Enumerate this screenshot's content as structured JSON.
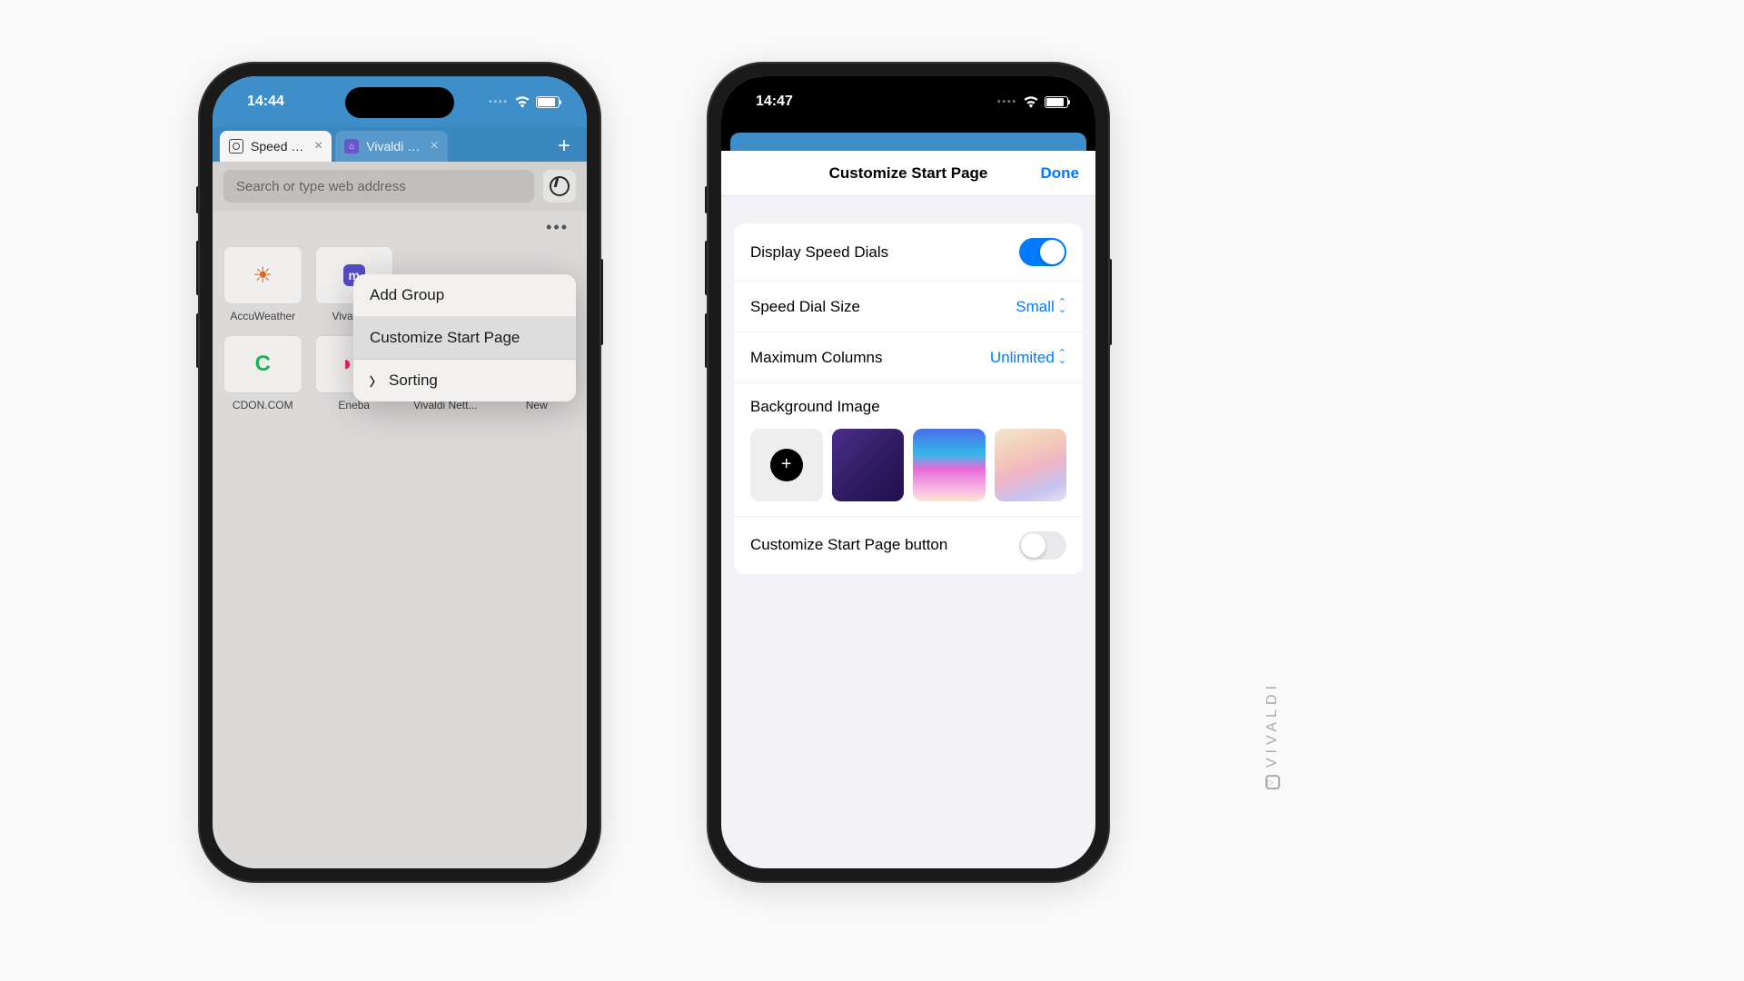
{
  "brand": "VIVALDI",
  "left": {
    "time": "14:44",
    "tabs": {
      "active": "Speed Dial",
      "inactive": "Vivaldi Socia..."
    },
    "addressPlaceholder": "Search or type web address",
    "speedDials": {
      "r0c0": "AccuWeather",
      "r0c1": "Vivaldi ...",
      "r1c0": "CDON.COM",
      "r1c1": "Eneba",
      "r1c2": "Vivaldi Nett...",
      "r1c3": "New"
    },
    "menu": {
      "addGroup": "Add Group",
      "customize": "Customize Start Page",
      "sorting": "Sorting"
    }
  },
  "right": {
    "time": "14:47",
    "header": {
      "title": "Customize Start Page",
      "done": "Done"
    },
    "settings": {
      "display": "Display Speed Dials",
      "sizeLabel": "Speed Dial Size",
      "sizeValue": "Small",
      "colsLabel": "Maximum Columns",
      "colsValue": "Unlimited",
      "bgLabel": "Background Image",
      "buttonLabel": "Customize Start Page button"
    }
  }
}
